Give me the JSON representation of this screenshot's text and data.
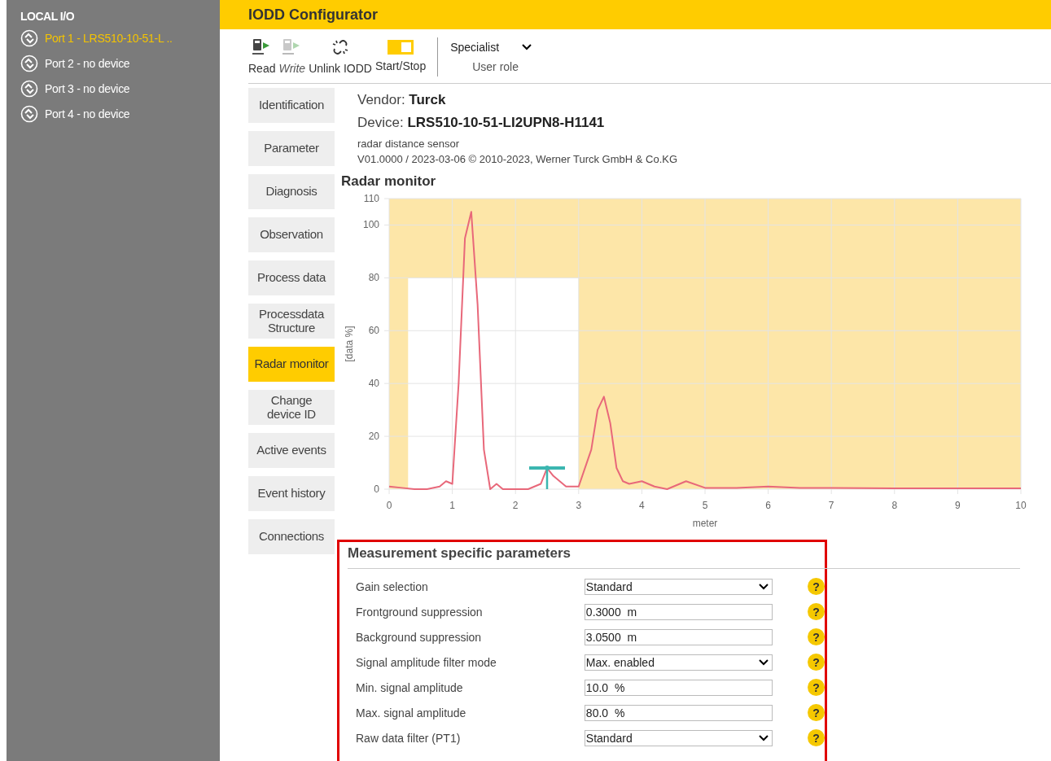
{
  "sidebar": {
    "title": "LOCAL I/O",
    "ports": [
      {
        "label": "Port 1 - LRS510-10-51-L ..",
        "selected": true
      },
      {
        "label": "Port 2 - no device",
        "selected": false
      },
      {
        "label": "Port 3 - no device",
        "selected": false
      },
      {
        "label": "Port 4 - no device",
        "selected": false
      }
    ]
  },
  "header": {
    "title": "IODD Configurator"
  },
  "toolbar": {
    "buttons": [
      {
        "label": "Read",
        "kind": "read",
        "disabled": false
      },
      {
        "label": "Write",
        "kind": "write",
        "disabled": true
      },
      {
        "label": "Unlink IODD",
        "kind": "unlink",
        "disabled": false
      },
      {
        "label": "Start/Stop",
        "kind": "toggle",
        "disabled": false,
        "on": true
      }
    ],
    "user_role": {
      "value": "Specialist",
      "label": "User role"
    }
  },
  "nav": [
    {
      "label": "Identification",
      "selected": false
    },
    {
      "label": "Parameter",
      "selected": false
    },
    {
      "label": "Diagnosis",
      "selected": false
    },
    {
      "label": "Observation",
      "selected": false
    },
    {
      "label": "Process data",
      "selected": false
    },
    {
      "label": "Processdata\nStructure",
      "selected": false
    },
    {
      "label": "Radar monitor",
      "selected": true
    },
    {
      "label": "Change\ndevice ID",
      "selected": false
    },
    {
      "label": "Active events",
      "selected": false
    },
    {
      "label": "Event history",
      "selected": false
    },
    {
      "label": "Connections",
      "selected": false
    }
  ],
  "device": {
    "vendor_label": "Vendor:",
    "vendor": "Turck",
    "device_label": "Device:",
    "device": "LRS510-10-51-LI2UPN8-H1141",
    "description": "radar distance sensor",
    "version": "V01.0000 / 2023-03-06 © 2010-2023, Werner Turck GmbH & Co.KG"
  },
  "radar": {
    "title": "Radar monitor",
    "chart_data": {
      "type": "line",
      "xlabel": "meter",
      "ylabel": "[data %]",
      "xlim": [
        0,
        10
      ],
      "ylim": [
        0,
        110
      ],
      "xticks": [
        0,
        1,
        2,
        3,
        4,
        5,
        6,
        7,
        8,
        9,
        10
      ],
      "yticks": [
        0,
        20,
        40,
        60,
        80,
        100,
        110
      ],
      "x": [
        0,
        0.2,
        0.4,
        0.6,
        0.8,
        0.9,
        1.0,
        1.1,
        1.2,
        1.3,
        1.4,
        1.5,
        1.6,
        1.7,
        1.8,
        2.0,
        2.2,
        2.4,
        2.5,
        2.6,
        2.8,
        3.0,
        3.2,
        3.3,
        3.4,
        3.5,
        3.6,
        3.7,
        3.8,
        4.0,
        4.2,
        4.4,
        4.7,
        5.0,
        5.5,
        6.0,
        6.5,
        7.0,
        8.0,
        9.0,
        10.0
      ],
      "grid": true,
      "series": [
        {
          "color": "#e8687a",
          "values": [
            1,
            0.5,
            0,
            0,
            1,
            3,
            2,
            40,
            95,
            105,
            70,
            15,
            0,
            2,
            0,
            0,
            0,
            2,
            8,
            5,
            1,
            1,
            15,
            30,
            35,
            25,
            8,
            3,
            2,
            3,
            1,
            0,
            3,
            0.5,
            0.5,
            1,
            0.5,
            0.5,
            0.3,
            0.3,
            0.3
          ]
        },
        {
          "color": "#3bb6b0",
          "marker": true,
          "values": [
            null,
            null,
            null,
            null,
            null,
            null,
            null,
            null,
            null,
            null,
            null,
            null,
            null,
            null,
            null,
            null,
            null,
            null,
            8,
            null,
            null,
            null,
            null,
            null,
            null,
            null,
            null,
            null,
            null,
            null,
            null,
            null,
            null,
            null,
            null,
            null,
            null,
            null,
            null,
            null,
            null
          ]
        }
      ],
      "bands": [
        {
          "axis": "x",
          "from": 0,
          "to": 0.3
        },
        {
          "axis": "x",
          "from": 3.0,
          "to": 10
        },
        {
          "axis": "y",
          "from": 80,
          "to": 110
        }
      ]
    }
  },
  "params": {
    "title": "Measurement specific parameters",
    "rows": [
      {
        "label": "Gain selection",
        "kind": "select",
        "value": "Standard",
        "help": "?"
      },
      {
        "label": "Frontground suppression",
        "kind": "input",
        "value": "0.3000  m",
        "help": "?"
      },
      {
        "label": "Background suppression",
        "kind": "input",
        "value": "3.0500  m",
        "help": "?"
      },
      {
        "label": "Signal amplitude filter mode",
        "kind": "select",
        "value": "Max. enabled",
        "help": "?"
      },
      {
        "label": "Min. signal amplitude",
        "kind": "input",
        "value": "10.0  %",
        "help": "?"
      },
      {
        "label": "Max. signal amplitude",
        "kind": "input",
        "value": "80.0  %",
        "help": "?"
      },
      {
        "label": "Raw data filter (PT1)",
        "kind": "select",
        "value": "Standard",
        "help": "?"
      }
    ]
  }
}
